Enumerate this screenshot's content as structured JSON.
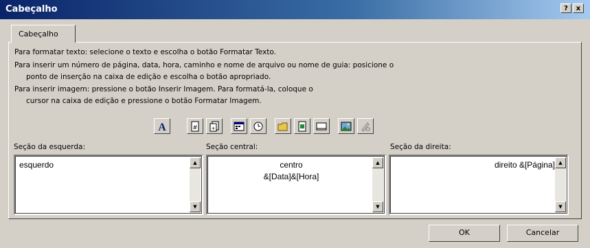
{
  "window": {
    "title": "Cabeçalho",
    "help_label": "?",
    "close_label": "x"
  },
  "tab": {
    "label": "Cabeçalho"
  },
  "instructions": [
    "Para formatar texto: selecione o texto e escolha o botão Formatar Texto.",
    "Para inserir um número de página, data, hora, caminho e nome de arquivo ou nome de guia: posicione o",
    "ponto de inserção na caixa de edição e escolha o botão apropriado.",
    "Para inserir imagem: pressione o botão Inserir Imagem. Para formatá-la, coloque o",
    "cursor na caixa de edição e pressione o botão Formatar Imagem."
  ],
  "toolbar": [
    {
      "icon": "format-text-icon"
    },
    {
      "icon": "page-number-icon"
    },
    {
      "icon": "total-pages-icon"
    },
    {
      "icon": "date-icon"
    },
    {
      "icon": "time-icon"
    },
    {
      "icon": "file-path-icon"
    },
    {
      "icon": "file-name-icon"
    },
    {
      "icon": "sheet-name-icon"
    },
    {
      "icon": "insert-picture-icon"
    },
    {
      "icon": "format-picture-icon"
    }
  ],
  "sections": {
    "left": {
      "label": "Seção da esquerda:",
      "lines": [
        "esquerdo"
      ]
    },
    "center": {
      "label": "Seção central:",
      "lines": [
        "centro",
        "&[Data]&[Hora]"
      ]
    },
    "right": {
      "label": "Seção da direita:",
      "lines": [
        "direito &[Página]"
      ]
    }
  },
  "buttons": {
    "ok": "OK",
    "cancel": "Cancelar"
  }
}
